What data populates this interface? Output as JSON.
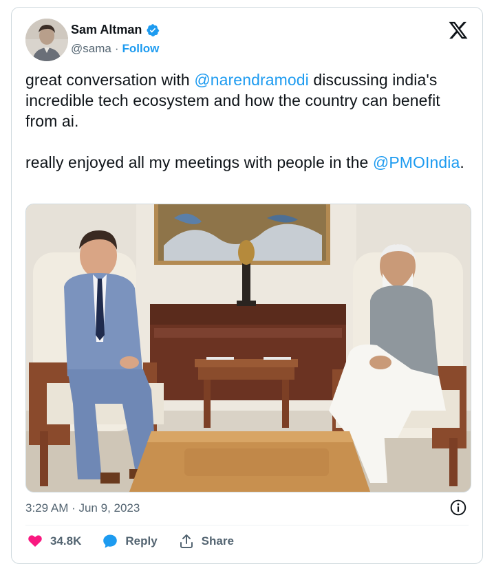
{
  "author": {
    "name": "Sam Altman",
    "handle": "@sama",
    "separator": "·",
    "follow_label": "Follow"
  },
  "tweet": {
    "p1_pre": "great conversation with ",
    "p1_mention": "@narendramodi",
    "p1_post": " discussing india's incredible tech ecosystem and how the country can benefit from ai.",
    "p2_pre": "really enjoyed all my meetings with people in the ",
    "p2_mention": "@PMOIndia",
    "p2_post": "."
  },
  "meta": {
    "timestamp": "3:29 AM · Jun 9, 2023"
  },
  "actions": {
    "likes": "34.8K",
    "reply_label": "Reply",
    "share_label": "Share"
  },
  "colors": {
    "link": "#1d9bf0",
    "like": "#f91880",
    "muted": "#536471",
    "text": "#0f1419"
  },
  "icons": {
    "verified": "verified-badge-icon",
    "brand": "x-logo-icon",
    "info": "info-icon",
    "like": "heart-icon",
    "reply": "speech-bubble-icon",
    "share": "share-upload-icon"
  }
}
